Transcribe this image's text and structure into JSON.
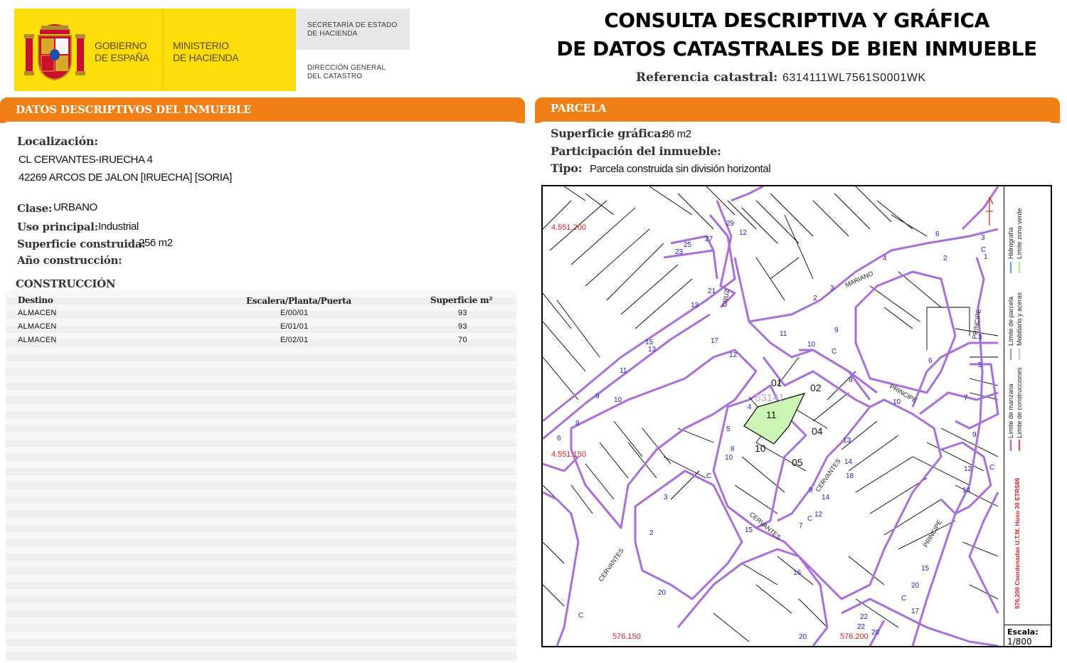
{
  "header": {
    "gobierno": [
      "GOBIERNO",
      "DE ESPAÑA"
    ],
    "ministerio": [
      "MINISTERIO",
      "DE HACIENDA"
    ],
    "secretaria": [
      "SECRETARÍA DE ESTADO",
      "DE HACIENDA"
    ],
    "direccion": [
      "DIRECCIÓN GENERAL",
      "DEL CATASTRO"
    ],
    "title_line1": "CONSULTA DESCRIPTIVA Y GRÁFICA",
    "title_line2": "DE DATOS CATASTRALES DE BIEN INMUEBLE",
    "ref_label": "Referencia catastral:",
    "ref_value": "6314111WL7561S0001WK"
  },
  "descriptivos": {
    "section_title": "DATOS DESCRIPTIVOS DEL INMUEBLE",
    "localizacion_label": "Localización:",
    "address_line1": "CL CERVANTES-IRUECHA 4",
    "address_line2": "42269 ARCOS DE JALON [IRUECHA] [SORIA]",
    "clase_label": "Clase:",
    "clase_value": "URBANO",
    "uso_label": "Uso principal:",
    "uso_value": "Industrial",
    "superficie_label": "Superficie construida:",
    "superficie_value": "256 m2",
    "anio_label": "Año construcción:",
    "construccion_title": "CONSTRUCCIÓN",
    "table": {
      "headers": [
        "Destino",
        "Escalera/Planta/Puerta",
        "Superficie m²"
      ],
      "rows": [
        [
          "ALMACEN",
          "E/00/01",
          "93"
        ],
        [
          "ALMACEN",
          "E/01/01",
          "93"
        ],
        [
          "ALMACEN",
          "E/02/01",
          "70"
        ]
      ]
    }
  },
  "parcela": {
    "section_title": "PARCELA",
    "sup_label": "Superficie gráfica:",
    "sup_value": "86 m2",
    "part_label": "Participación del inmueble:",
    "tipo_label": "Tipo:",
    "tipo_value": "Parcela construida sin división horizontal"
  },
  "map": {
    "coord_y1": "4.551.200",
    "coord_y2": "4.551.150",
    "coord_x1": "576.150",
    "coord_x2": "576.200",
    "parcel_ref": "63141",
    "parcel_numbers": [
      "01",
      "02",
      "11",
      "04",
      "10",
      "05"
    ],
    "streets": [
      "CRUZ",
      "MARIANO",
      "PRINCIPE",
      "PRINCIPE",
      "CERVANTES",
      "CERVANTES",
      "CERVANTES",
      "PRINCIPE"
    ],
    "legend_items": [
      "Límite de manzana",
      "Límite de construcciones",
      "Límite de parcela",
      "Mobiliario y aceras",
      "Hidrografía",
      "Límite zona verde"
    ],
    "coord_system": "576,200 Coordenadas U.T.M. Huso 30 ETRS89",
    "scale_label": "Escala:",
    "scale_value": "1/800",
    "colors": {
      "manzana": "#a86fdb",
      "parcela": "#000000",
      "zona_verde": "#ccf5b5",
      "coords": "#d02020",
      "labels": "#2020c0"
    }
  }
}
